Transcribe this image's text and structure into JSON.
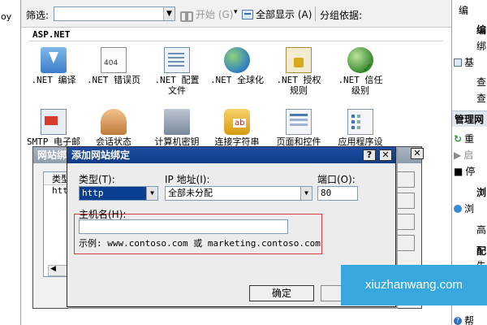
{
  "left_strip": {
    "text": "oy"
  },
  "toolbar": {
    "filter_label": "筛选:",
    "start_label": "开始 (G)",
    "show_all_label": "全部显示 (A)",
    "group_label": "分组依据:"
  },
  "section": {
    "title": "ASP.NET"
  },
  "features_row1": [
    {
      "label": ".NET 编译",
      "icon": "compile-icon"
    },
    {
      "label": ".NET 错误页",
      "icon": "error-page-icon"
    },
    {
      "label": ".NET 配置文件",
      "icon": "config-icon"
    },
    {
      "label": ".NET 全球化",
      "icon": "globe-icon"
    },
    {
      "label": ".NET 授权规则",
      "icon": "authorization-icon"
    },
    {
      "label": ".NET 信任级别",
      "icon": "trust-icon"
    }
  ],
  "features_row2": [
    {
      "label": "SMTP 电子邮",
      "icon": "smtp-icon"
    },
    {
      "label": "会话状态",
      "icon": "session-icon"
    },
    {
      "label": "计算机密钥",
      "icon": "machine-key-icon"
    },
    {
      "label": "连接字符串",
      "icon": "connection-string-icon"
    },
    {
      "label": "页面和控件",
      "icon": "pages-icon"
    },
    {
      "label": "应用程序设",
      "icon": "app-settings-icon"
    }
  ],
  "right_pane": {
    "item1": "编",
    "item2": "编",
    "item3": "绑",
    "item4": "基",
    "item5": "查",
    "item6": "查",
    "manage_head": "管理网",
    "restart": "重",
    "start": "启",
    "stop": "停",
    "browse_head": "浏",
    "browse": "浏",
    "advanced": "高",
    "config_head": "配",
    "limits": "失",
    "help": "帮"
  },
  "back_dialog": {
    "title": "网站绑",
    "col_type": "类型",
    "row1": "http"
  },
  "dialog": {
    "title": "添加网站绑定",
    "type_label": "类型(T):",
    "type_value": "http",
    "ip_label": "IP 地址(I):",
    "ip_value": "全部未分配",
    "port_label": "端口(O):",
    "port_value": "80",
    "hostname_label": "主机名(H):",
    "hostname_value": "",
    "example": "示例: www.contoso.com 或 marketing.contoso.com",
    "ok_label": "确定"
  },
  "watermark": {
    "text": "xiuzhanwang.com"
  },
  "colors": {
    "title_bar": "#0f3a86",
    "highlight": "#e0393b",
    "watermark": "#37a8de"
  }
}
